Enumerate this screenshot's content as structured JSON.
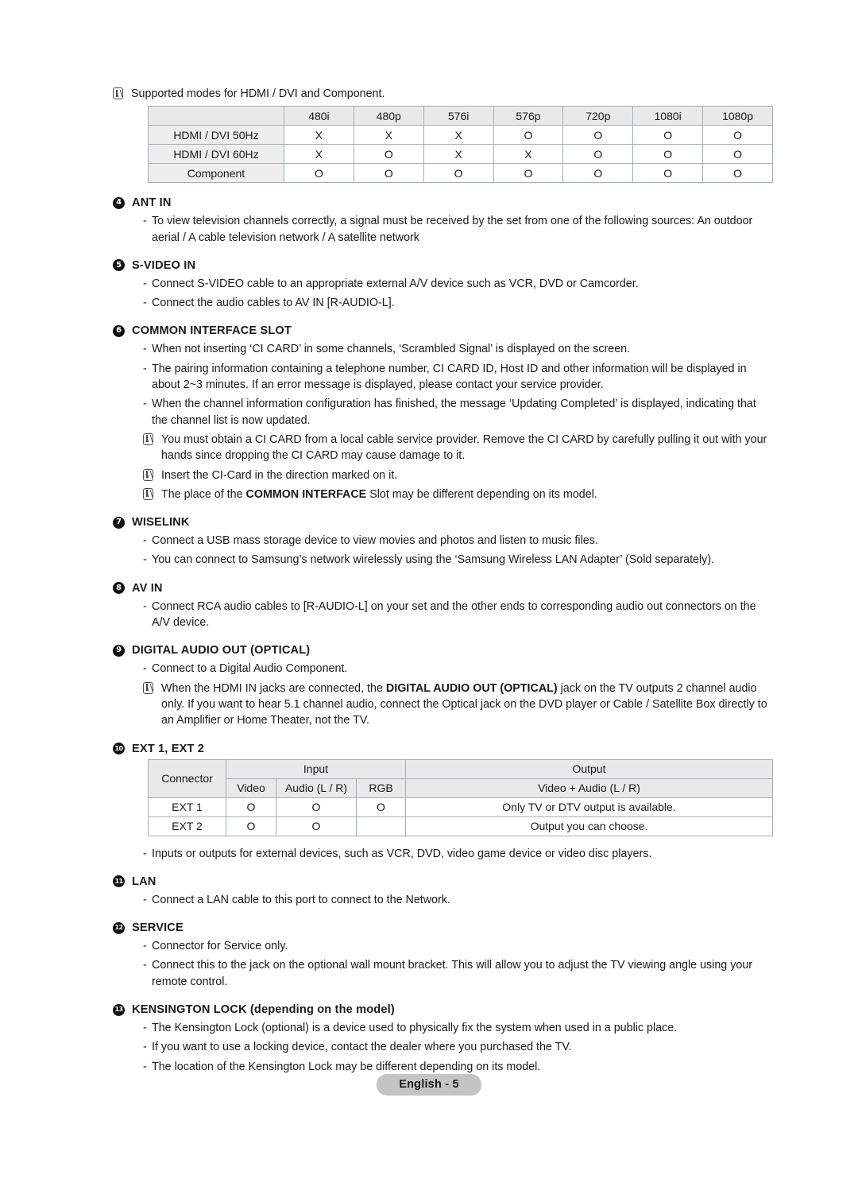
{
  "page": {
    "footer_label": "English - 5",
    "note_icon_name": "note-pencil-icon"
  },
  "intro_note": {
    "text": "Supported modes for HDMI / DVI and Component."
  },
  "modes_table": {
    "columns": [
      "",
      "480i",
      "480p",
      "576i",
      "576p",
      "720p",
      "1080i",
      "1080p"
    ],
    "rows": [
      {
        "label": "HDMI / DVI 50Hz",
        "values": [
          "X",
          "X",
          "X",
          "O",
          "O",
          "O",
          "O"
        ]
      },
      {
        "label": "HDMI / DVI 60Hz",
        "values": [
          "X",
          "O",
          "X",
          "X",
          "O",
          "O",
          "O"
        ]
      },
      {
        "label": "Component",
        "values": [
          "O",
          "O",
          "O",
          "O",
          "O",
          "O",
          "O"
        ]
      }
    ]
  },
  "sections": [
    {
      "num": "4",
      "title": "ANT IN",
      "items": [
        {
          "kind": "dash",
          "text": "To view television channels correctly, a signal must be received by the set from one of the following sources: An outdoor aerial / A cable television network / A satellite network"
        }
      ]
    },
    {
      "num": "5",
      "title": "S-VIDEO IN",
      "items": [
        {
          "kind": "dash",
          "text": "Connect S-VIDEO cable to an appropriate external A/V device such as VCR, DVD or Camcorder."
        },
        {
          "kind": "dash",
          "text": "Connect the audio cables to AV IN [R-AUDIO-L]."
        }
      ]
    },
    {
      "num": "6",
      "title": "COMMON INTERFACE SLOT",
      "items": [
        {
          "kind": "dash",
          "text": "When not inserting ‘CI CARD’ in some channels, ‘Scrambled Signal’ is displayed on the screen."
        },
        {
          "kind": "dash",
          "text": "The pairing information containing a telephone number, CI CARD ID, Host ID and other information will be displayed in about 2~3 minutes. If an error message is displayed, please contact your service provider."
        },
        {
          "kind": "dash",
          "text": "When the channel information configuration has finished, the message ‘Updating Completed’ is displayed, indicating that the channel list is now updated."
        },
        {
          "kind": "note",
          "text": "You must obtain a CI CARD from a local cable service provider. Remove the CI CARD by carefully pulling it out with your hands since dropping the CI CARD may cause damage to it."
        },
        {
          "kind": "note",
          "text": "Insert the CI-Card in the direction marked on it."
        },
        {
          "kind": "note",
          "pre": "The place of the ",
          "bold": "COMMON INTERFACE",
          "post": " Slot may be different depending on its model."
        }
      ]
    },
    {
      "num": "7",
      "title": "WISELINK",
      "items": [
        {
          "kind": "dash",
          "text": "Connect a USB mass storage device to view movies and photos and listen to music files."
        },
        {
          "kind": "dash",
          "text": "You can connect to Samsung’s network wirelessly using the ‘Samsung Wireless LAN Adapter’ (Sold separately)."
        }
      ]
    },
    {
      "num": "8",
      "title": "AV IN",
      "items": [
        {
          "kind": "dash",
          "text": "Connect RCA audio cables to [R-AUDIO-L] on your set and the other ends to corresponding audio out connectors on the A/V device."
        }
      ]
    },
    {
      "num": "9",
      "title": "DIGITAL AUDIO OUT (OPTICAL)",
      "items": [
        {
          "kind": "dash",
          "text": "Connect to a Digital Audio Component."
        },
        {
          "kind": "note",
          "pre": "When the HDMI IN jacks are connected, the ",
          "bold": "DIGITAL AUDIO OUT (OPTICAL)",
          "post": " jack on the TV outputs 2 channel audio only. If you want to hear 5.1 channel audio, connect the Optical jack on the DVD player or Cable / Satellite Box directly to an Amplifier or Home Theater, not the TV."
        }
      ]
    }
  ],
  "ext_section": {
    "num": "10",
    "title": "EXT 1, EXT 2",
    "after_table_item": "Inputs or outputs for external devices, such as VCR, DVD, video game device or video disc players."
  },
  "ext_table": {
    "connector_header": "Connector",
    "input_header": "Input",
    "output_header": "Output",
    "sub_headers": [
      "Video",
      "Audio (L / R)",
      "RGB"
    ],
    "output_sub_header": "Video + Audio (L / R)",
    "rows": [
      {
        "label": "EXT 1",
        "video": "O",
        "audio": "O",
        "rgb": "O",
        "output": "Only TV or DTV output is available."
      },
      {
        "label": "EXT 2",
        "video": "O",
        "audio": "O",
        "rgb": "",
        "output": "Output you can choose."
      }
    ]
  },
  "tail_sections": [
    {
      "num": "11",
      "title": "LAN",
      "items": [
        {
          "kind": "dash",
          "text": "Connect a LAN cable to this port to connect to the Network."
        }
      ]
    },
    {
      "num": "12",
      "title": "SERVICE",
      "items": [
        {
          "kind": "dash",
          "text": "Connector for Service only."
        },
        {
          "kind": "dash",
          "text": "Connect this to the jack on the optional wall mount bracket. This will allow you to adjust the TV viewing angle using your remote control."
        }
      ]
    },
    {
      "num": "13",
      "title": "KENSINGTON LOCK (depending on the model)",
      "items": [
        {
          "kind": "dash",
          "text": "The Kensington Lock (optional) is a device used to physically fix the system when used in a public place."
        },
        {
          "kind": "dash",
          "text": "If you want to use a locking device, contact the dealer where you purchased the TV."
        },
        {
          "kind": "dash",
          "text": "The location of the Kensington Lock may be different depending on its model."
        }
      ]
    }
  ]
}
